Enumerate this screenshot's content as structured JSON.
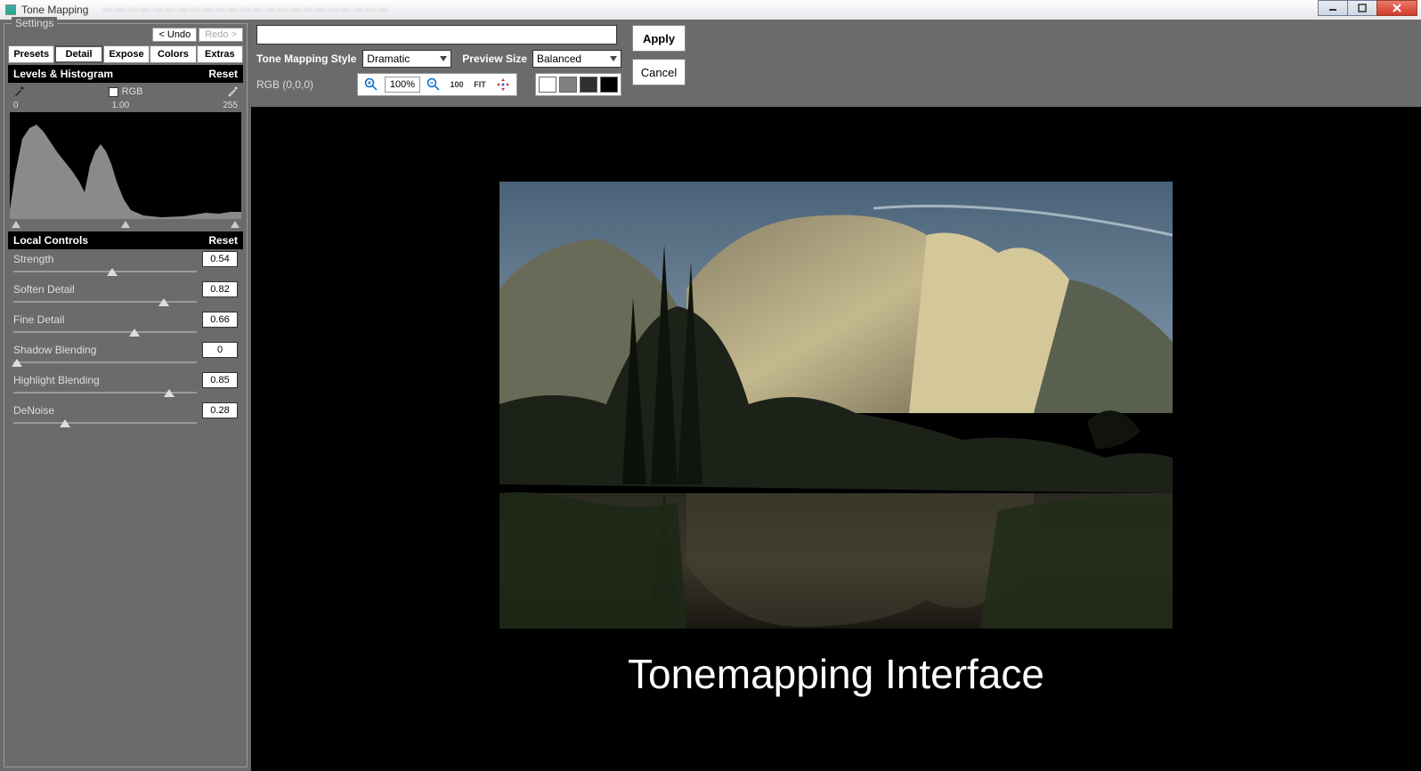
{
  "window": {
    "title": "Tone Mapping",
    "min": "—",
    "max": "☐",
    "close": "✕"
  },
  "sidebar": {
    "settings_label": "Settings",
    "undo": "< Undo",
    "redo": "Redo >",
    "tabs": [
      "Presets",
      "Detail",
      "Expose",
      "Colors",
      "Extras"
    ],
    "active_tab": 1,
    "levels": {
      "title": "Levels & Histogram",
      "reset": "Reset",
      "rgb_label": "RGB",
      "axis_min": "0",
      "axis_mid": "1.00",
      "axis_max": "255"
    },
    "local": {
      "title": "Local Controls",
      "reset": "Reset",
      "controls": [
        {
          "label": "Strength",
          "value": "0.54",
          "pos": 0.54
        },
        {
          "label": "Soften Detail",
          "value": "0.82",
          "pos": 0.82
        },
        {
          "label": "Fine Detail",
          "value": "0.66",
          "pos": 0.66
        },
        {
          "label": "Shadow Blending",
          "value": "0",
          "pos": 0.02
        },
        {
          "label": "Highlight Blending",
          "value": "0.85",
          "pos": 0.85
        },
        {
          "label": "DeNoise",
          "value": "0.28",
          "pos": 0.28
        }
      ]
    }
  },
  "toolbar": {
    "style_label": "Tone Mapping Style",
    "style_value": "Dramatic",
    "preview_label": "Preview Size",
    "preview_value": "Balanced",
    "rgb_readout": "RGB (0,0,0)",
    "zoom_value": "100%",
    "zoom_100": "100",
    "zoom_fit": "FIT",
    "swatches": [
      "#ffffff",
      "#808080",
      "#303030",
      "#000000"
    ],
    "apply": "Apply",
    "cancel": "Cancel"
  },
  "caption": "Tonemapping Interface"
}
